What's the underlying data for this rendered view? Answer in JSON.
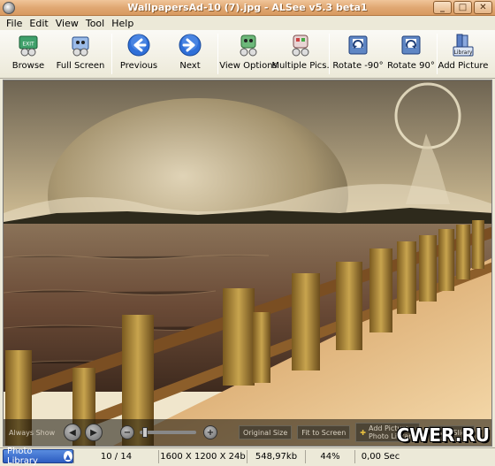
{
  "window": {
    "title": "WallpapersAd-10 (7).jpg - ALSee v5.3 beta1",
    "controls": [
      "_",
      "□",
      "✕"
    ]
  },
  "menu": [
    "File",
    "Edit",
    "View",
    "Tool",
    "Help"
  ],
  "toolbar": {
    "browse": "Browse",
    "full_screen": "Full Screen",
    "previous": "Previous",
    "next": "Next",
    "view_options": "View Options",
    "multiple_pics": "Multiple Pics.",
    "rotate_left": "Rotate -90°",
    "rotate_right": "Rotate 90°",
    "add_picture": "Add Picture",
    "library_icon_text": "Library",
    "exit_icon_text": "EXIT"
  },
  "overlay": {
    "always_show": "Always Show",
    "original_size": "Original Size",
    "fit_to_screen": "Fit to Screen",
    "add_picture_line1": "Add Picture",
    "add_picture_line2": "Photo Library",
    "start_slide": "Start Slide"
  },
  "status": {
    "photo_library": "Photo Library",
    "index": "10 / 14",
    "dimensions": "1600 X 1200 X 24b",
    "file_size": "548,97kb",
    "zoom": "44%",
    "time": "0,00 Sec"
  },
  "watermark": "CWER.RU",
  "colors": {
    "title_bar": "#e0a873",
    "status_library": "#2c5cc0",
    "nav_arrow": "#2f6fd8"
  }
}
